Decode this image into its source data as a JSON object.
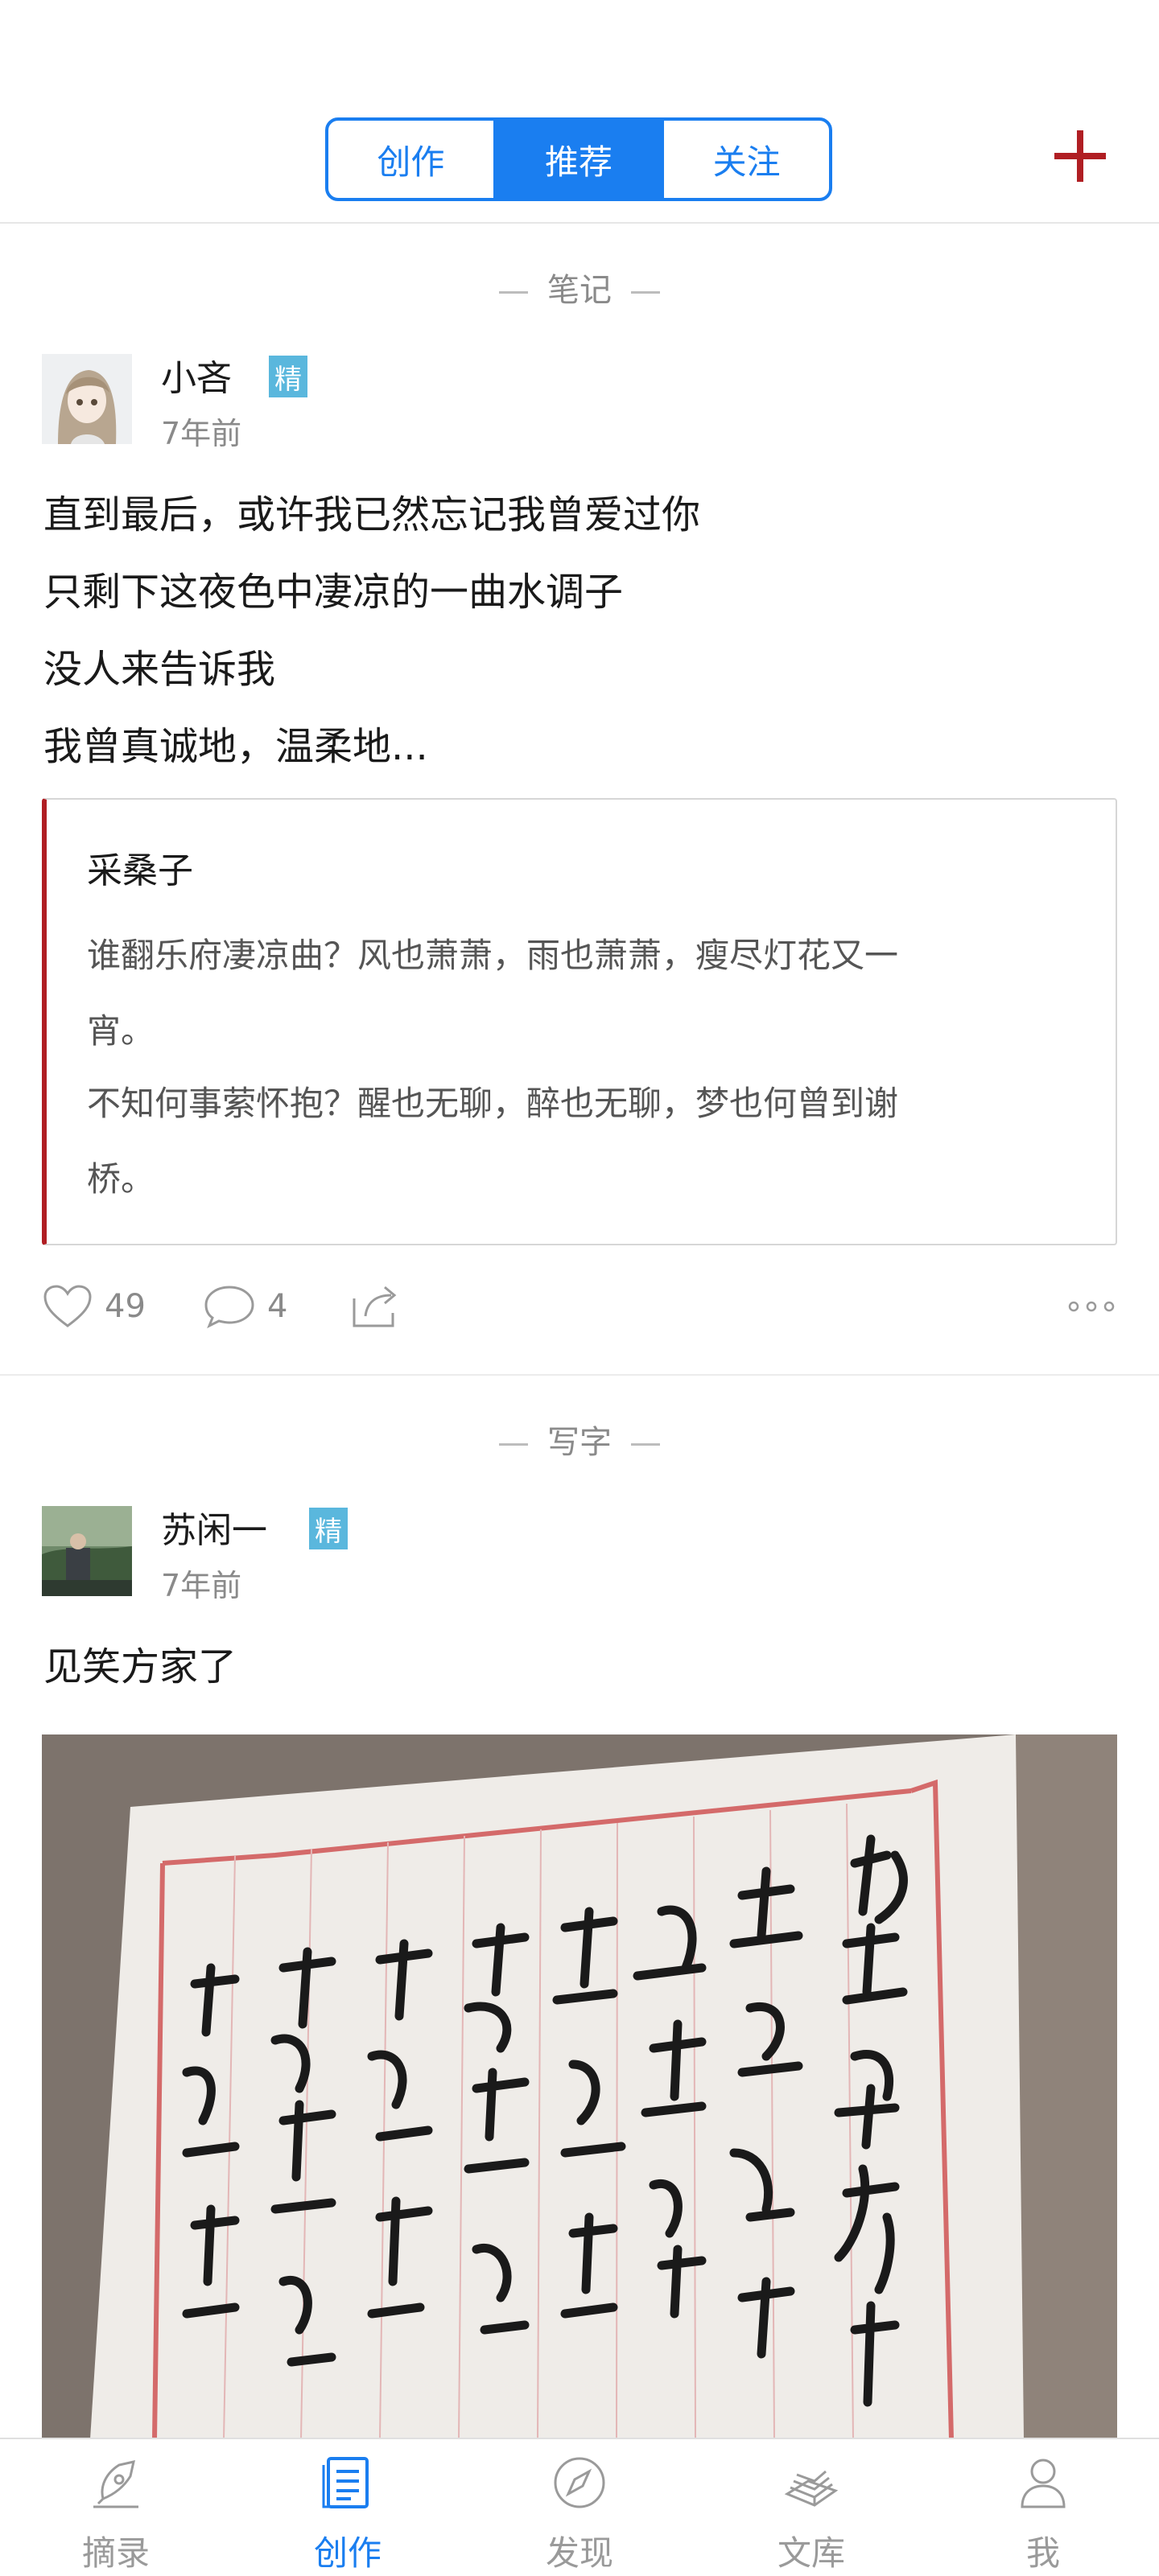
{
  "header": {
    "tabs": [
      {
        "label": "创作",
        "active": false
      },
      {
        "label": "推荐",
        "active": true
      },
      {
        "label": "关注",
        "active": false
      }
    ],
    "add_icon": "plus-icon",
    "accent_color": "#1a7ef0",
    "brand_red": "#b01e23"
  },
  "posts": [
    {
      "category": "笔记",
      "author": "小吝",
      "badge": "精",
      "time": "7年前",
      "lines": [
        "直到最后，或许我已然忘记我曾爱过你",
        "只剩下这夜色中凄凉的一曲水调子",
        "没人来告诉我",
        "我曾真诚地，温柔地..."
      ],
      "quote": {
        "title": "采桑子",
        "lines": [
          "谁翻乐府凄凉曲？风也萧萧，雨也萧萧，瘦尽灯花又一",
          "宵。",
          "不知何事萦怀抱？醒也无聊，醉也无聊，梦也何曾到谢",
          "桥。"
        ]
      },
      "likes": "49",
      "comments": "4"
    },
    {
      "category": "写字",
      "author": "苏闲一",
      "badge": "精",
      "time": "7年前",
      "lines": [
        "见笑方家了"
      ]
    }
  ],
  "nav": [
    {
      "label": "摘录",
      "icon": "pen-nib-icon",
      "active": false
    },
    {
      "label": "创作",
      "icon": "document-icon",
      "active": true
    },
    {
      "label": "发现",
      "icon": "compass-icon",
      "active": false
    },
    {
      "label": "文库",
      "icon": "books-icon",
      "active": false
    },
    {
      "label": "我",
      "icon": "person-icon",
      "active": false
    }
  ]
}
